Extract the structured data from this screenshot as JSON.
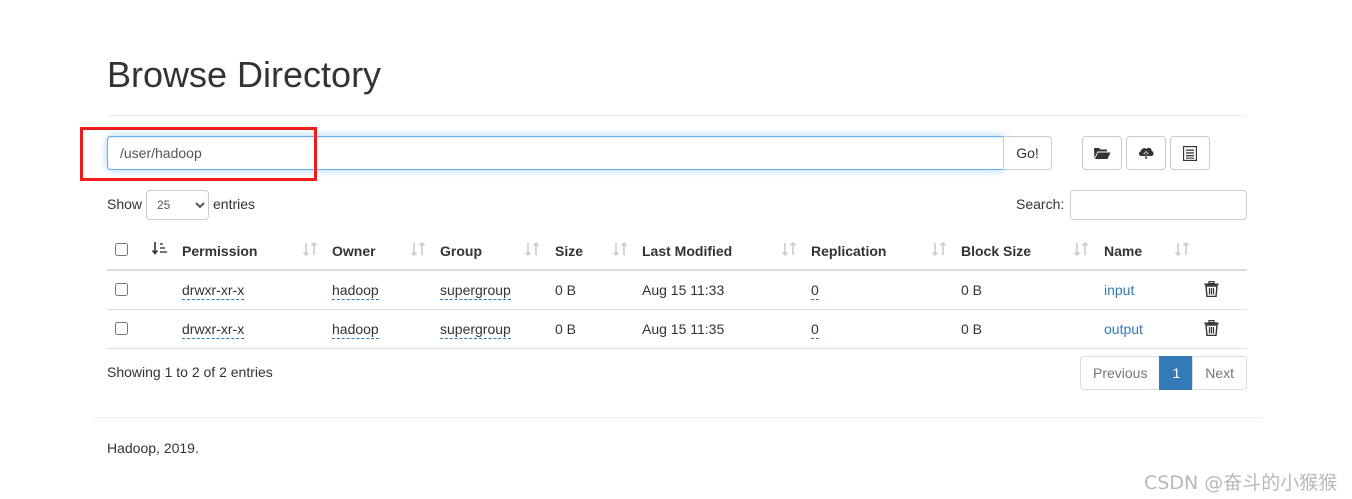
{
  "page": {
    "title": "Browse Directory"
  },
  "path_bar": {
    "value": "/user/hadoop",
    "go_label": "Go!"
  },
  "toolbar": {
    "icons": [
      "folder-open-icon",
      "cloud-upload-icon",
      "list-icon"
    ]
  },
  "table_controls": {
    "show_label": "Show",
    "page_length": "25",
    "entries_label": "entries",
    "search_label": "Search:",
    "search_value": ""
  },
  "table": {
    "columns": [
      "Permission",
      "Owner",
      "Group",
      "Size",
      "Last Modified",
      "Replication",
      "Block Size",
      "Name"
    ],
    "rows": [
      {
        "permission": "drwxr-xr-x",
        "owner": "hadoop",
        "group": "supergroup",
        "size": "0 B",
        "modified": "Aug 15 11:33",
        "replication": "0",
        "block_size": "0 B",
        "name": "input"
      },
      {
        "permission": "drwxr-xr-x",
        "owner": "hadoop",
        "group": "supergroup",
        "size": "0 B",
        "modified": "Aug 15 11:35",
        "replication": "0",
        "block_size": "0 B",
        "name": "output"
      }
    ]
  },
  "pagination": {
    "info": "Showing 1 to 2 of 2 entries",
    "previous": "Previous",
    "current": "1",
    "next": "Next"
  },
  "footer": {
    "text": "Hadoop, 2019."
  },
  "watermark": "CSDN @奋斗的小猴猴",
  "colors": {
    "link": "#337ab7",
    "highlight": "#ee1c1c",
    "active_page": "#337ab7"
  }
}
